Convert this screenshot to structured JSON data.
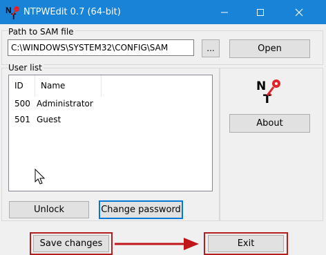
{
  "window": {
    "title": "NTPWEdit 0.7 (64-bit)",
    "icon": "ntpwedit-logo-icon",
    "controls": [
      "minimize-icon",
      "maximize-icon",
      "close-icon"
    ]
  },
  "path_section": {
    "label": "Path to SAM file",
    "value": "C:\\WINDOWS\\SYSTEM32\\CONFIG\\SAM",
    "browse_label": "...",
    "open_label": "Open"
  },
  "user_list": {
    "label": "User list",
    "columns": [
      "ID",
      "Name"
    ],
    "rows": [
      {
        "id": "500",
        "name": "Administrator"
      },
      {
        "id": "501",
        "name": "Guest"
      }
    ]
  },
  "buttons": {
    "unlock": "Unlock",
    "change_password": "Change password",
    "about": "About",
    "save_changes": "Save changes",
    "exit": "Exit"
  },
  "annotation": {
    "highlight_color": "#b31d1d",
    "arrow_color": "#c0161b"
  },
  "colors": {
    "titlebar": "#1883d7",
    "focus_border": "#0078d7"
  }
}
